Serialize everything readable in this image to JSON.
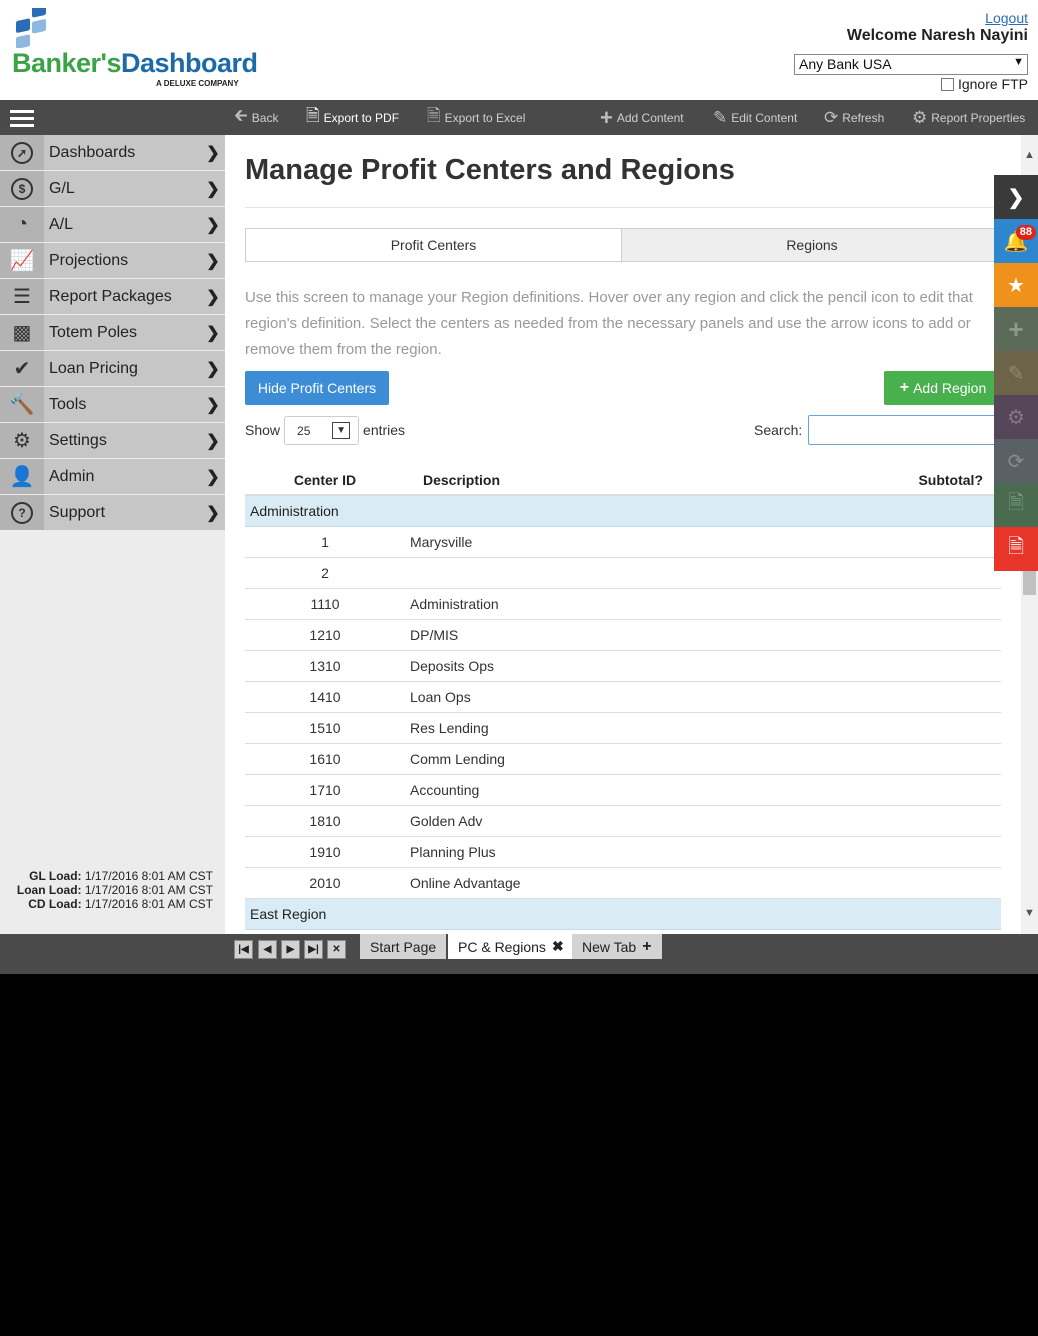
{
  "header": {
    "logo_banker": "Banker's",
    "logo_dashboard": "Dashboard",
    "logo_tagline": "A DELUXE COMPANY",
    "logout": "Logout",
    "welcome": "Welcome  Naresh Nayini",
    "bank": "Any Bank USA",
    "ignore_ftp": "Ignore FTP"
  },
  "toolbar": {
    "back": "Back",
    "export_pdf": "Export to PDF",
    "export_excel": "Export to Excel",
    "add_content": "Add Content",
    "edit_content": "Edit Content",
    "refresh": "Refresh",
    "report_properties": "Report Properties"
  },
  "sidebar": {
    "items": [
      {
        "label": "Dashboards",
        "icon": "compass-icon"
      },
      {
        "label": "G/L",
        "icon": "dollar-icon"
      },
      {
        "label": "A/L",
        "icon": "pie-chart-icon"
      },
      {
        "label": "Projections",
        "icon": "line-chart-icon"
      },
      {
        "label": "Report Packages",
        "icon": "layers-icon"
      },
      {
        "label": "Totem Poles",
        "icon": "bar-chart-icon"
      },
      {
        "label": "Loan Pricing",
        "icon": "check-icon"
      },
      {
        "label": "Tools",
        "icon": "hammer-icon"
      },
      {
        "label": "Settings",
        "icon": "gear-icon"
      },
      {
        "label": "Admin",
        "icon": "user-icon"
      },
      {
        "label": "Support",
        "icon": "help-icon"
      }
    ],
    "load": {
      "gl_label": "GL Load:",
      "gl_value": "1/17/2016 8:01 AM CST",
      "loan_label": "Loan Load:",
      "loan_value": "1/17/2016 8:01 AM CST",
      "cd_label": "CD Load:",
      "cd_value": "1/17/2016 8:01 AM CST"
    }
  },
  "main": {
    "title": "Manage Profit Centers and Regions",
    "tabs": [
      "Profit Centers",
      "Regions"
    ],
    "intro": "Use this screen to manage your Region definitions. Hover over any region and click the pencil icon to edit that region's definition. Select the centers as needed from the necessary panels and use the arrow icons to add or remove them from the region.",
    "hide_button": "Hide Profit Centers",
    "add_region_button": "Add Region",
    "show_label": "Show",
    "entries_value": "25",
    "entries_label": "entries",
    "search_label": "Search:",
    "search_value": "",
    "columns": [
      "Center ID",
      "Description",
      "Subtotal?"
    ],
    "groups": [
      {
        "name": "Administration",
        "rows": [
          {
            "id": "1",
            "desc": "Marysville"
          },
          {
            "id": "2",
            "desc": ""
          },
          {
            "id": "1110",
            "desc": "Administration"
          },
          {
            "id": "1210",
            "desc": "DP/MIS"
          },
          {
            "id": "1310",
            "desc": "Deposits Ops"
          },
          {
            "id": "1410",
            "desc": "Loan Ops"
          },
          {
            "id": "1510",
            "desc": "Res Lending"
          },
          {
            "id": "1610",
            "desc": "Comm Lending"
          },
          {
            "id": "1710",
            "desc": "Accounting"
          },
          {
            "id": "1810",
            "desc": "Golden Adv"
          },
          {
            "id": "1910",
            "desc": "Planning Plus"
          },
          {
            "id": "2010",
            "desc": "Online Advantage"
          }
        ]
      },
      {
        "name": "East Region",
        "rows": []
      }
    ]
  },
  "right_panel": {
    "notifications": "88",
    "colors": [
      "#3a3a3a",
      "#2e86cf",
      "#f0911c",
      "#5c6b59",
      "#6b6449",
      "#56465a",
      "#5a6166",
      "#4a6b50",
      "#e8352a"
    ]
  },
  "bottom": {
    "tabs": [
      "Start Page",
      "PC & Regions",
      "New Tab"
    ]
  }
}
